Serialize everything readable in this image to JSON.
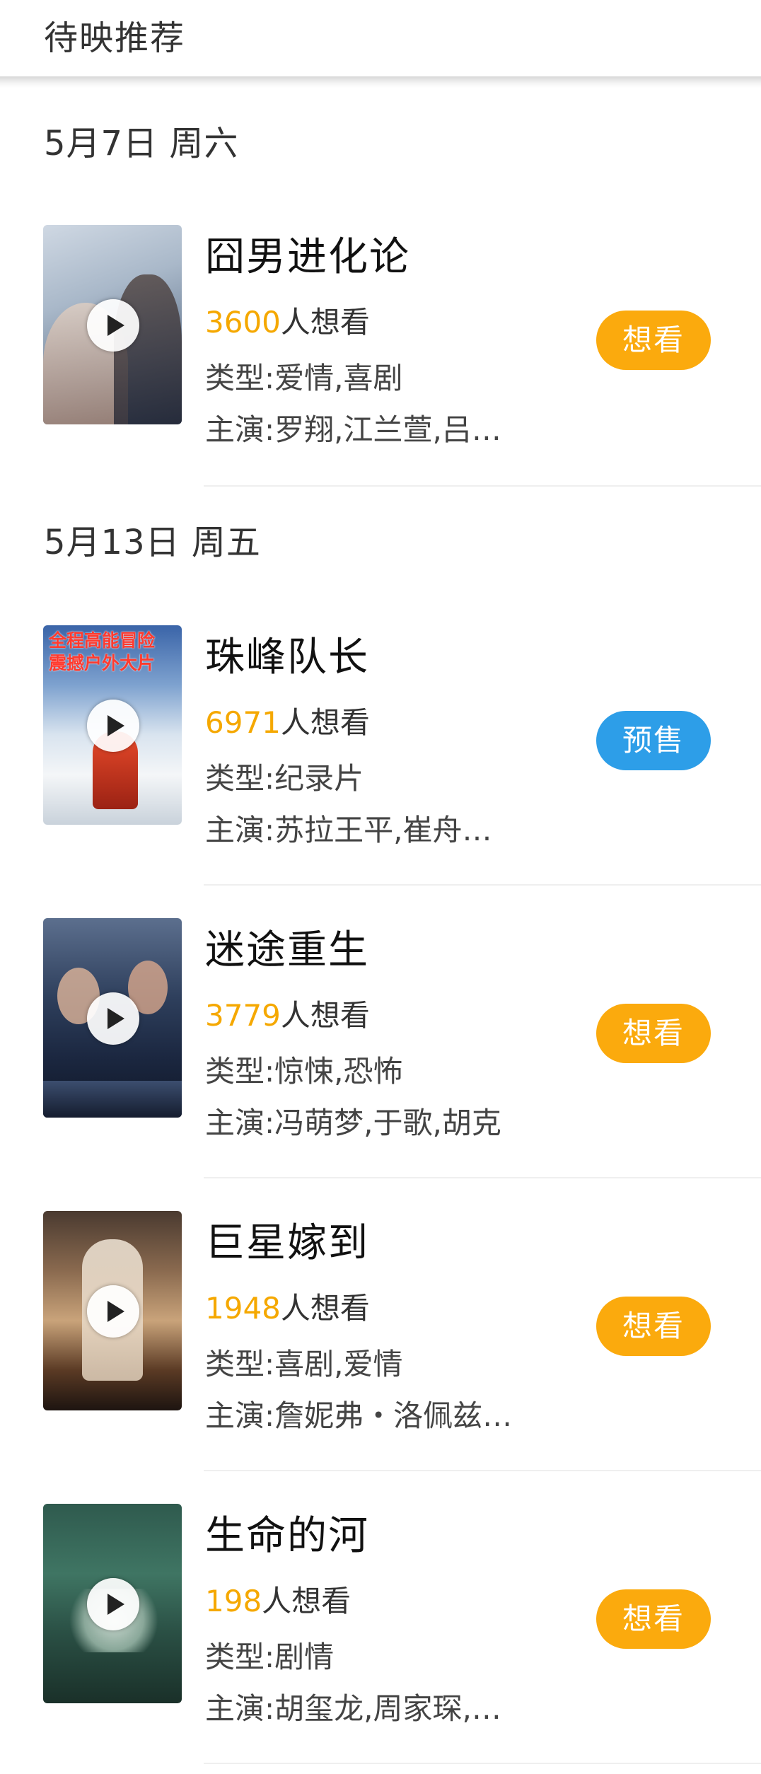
{
  "header": {
    "title": "待映推荐"
  },
  "sections": [
    {
      "date": "5月7日 周六"
    },
    {
      "date": "5月13日 周五"
    }
  ],
  "movies": [
    {
      "title": "囧男进化论",
      "want_count": "3600",
      "want_suffix": "人想看",
      "genre": "类型:爱情,喜剧",
      "cast": "主演:罗翔,江兰萱,吕…",
      "action": "想看",
      "action_color": "#fbaa0d"
    },
    {
      "title": "珠峰队长",
      "want_count": "6971",
      "want_suffix": "人想看",
      "genre": "类型:纪录片",
      "cast": "主演:苏拉王平,崔舟…",
      "action": "预售",
      "action_color": "#2d9ee8",
      "poster_text": "全程高能冒险\n震撼户外大片"
    },
    {
      "title": "迷途重生",
      "want_count": "3779",
      "want_suffix": "人想看",
      "genre": "类型:惊悚,恐怖",
      "cast": "主演:冯萌梦,于歌,胡克",
      "action": "想看",
      "action_color": "#fbaa0d"
    },
    {
      "title": "巨星嫁到",
      "want_count": "1948",
      "want_suffix": "人想看",
      "genre": "类型:喜剧,爱情",
      "cast": "主演:詹妮弗・洛佩兹…",
      "action": "想看",
      "action_color": "#fbaa0d"
    },
    {
      "title": "生命的河",
      "want_count": "198",
      "want_suffix": "人想看",
      "genre": "类型:剧情",
      "cast": "主演:胡玺龙,周家琛,…",
      "action": "想看",
      "action_color": "#fbaa0d"
    }
  ],
  "colors": {
    "accent_orange": "#fbaa0d",
    "presale_blue": "#2d9ee8",
    "want_number": "#f5a800"
  }
}
